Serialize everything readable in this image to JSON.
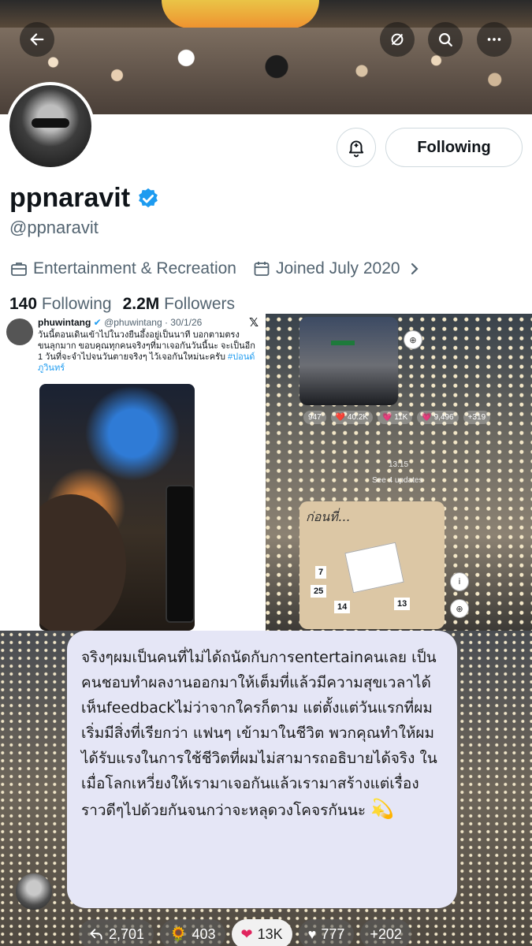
{
  "profile": {
    "display_name": "ppnaravit",
    "handle": "@ppnaravit",
    "category": "Entertainment & Recreation",
    "joined": "Joined July 2020",
    "following_count": "140",
    "following_label": "Following",
    "followers_count": "2.2M",
    "followers_label": "Followers",
    "follow_button": "Following"
  },
  "embedded_tweet": {
    "author": "phuwintang",
    "handle_date": "@phuwintang · 30/1/26",
    "text": "วันนี้ตอนเดินเข้าไปในวงยืนอึ้งอยู่เป็นนาที บอกตามตรง ขนลุกมาก ขอบคุณทุกคนจริงๆที่มาเจอกันวันนี้นะ จะเป็นอีก 1 วันที่จะจำไปจนวันตายจริงๆ ไว้เจอกันใหม่นะครับ",
    "hashtag": "#ปอนด์ภูวินทร์"
  },
  "story": {
    "reactions": [
      "947",
      "❤️ 40.2K",
      "💗 11K",
      "💗 9,496",
      "+319"
    ],
    "time": "13:15",
    "updates": "See 4 updates"
  },
  "calendar": {
    "title": "ก่อนที่...",
    "n1": "25",
    "n2": "14",
    "n3": "13",
    "n4": "7"
  },
  "message": {
    "text": "จริงๆผมเป็นคนที่ไม่ได้ถนัดกับการentertainคนเลย เป็นคนชอบทำผลงานออกมาให้เต็มที่แล้วมีความสุขเวลาได้เห็นfeedbackไม่ว่าจากใครก็ตาม แต่ตั้งแต่วันแรกที่ผมเริ่มมีสิ่งที่เรียกว่า แฟนๆ เข้ามาในชีวิต พวกคุณทำให้ผมได้รับแรงในการใช้ชีวิตที่ผมไม่สามารถอธิบายได้จริง ในเมื่อโลกเหวี่ยงให้เรามาเจอกันแล้วเรามาสร้างแต่เรื่องราวดีๆไปด้วยกันจนกว่าจะหลุดวงโคจรกันนะ",
    "emoji": "💫"
  },
  "reactions": {
    "reply": "2,701",
    "sunflower": "403",
    "heart": "13K",
    "black_heart": "777",
    "more": "+202"
  },
  "colors": {
    "verified": "#1d9bf0",
    "secondary_text": "#536471",
    "border": "#cfd9de"
  }
}
